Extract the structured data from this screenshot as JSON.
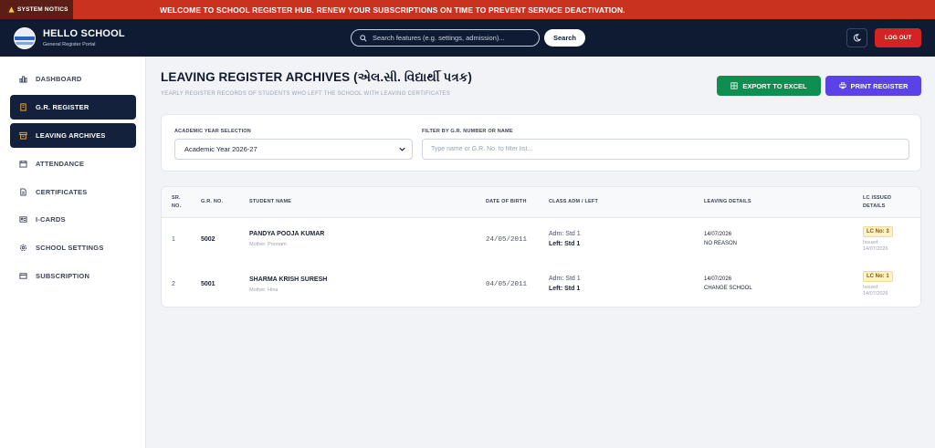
{
  "notice": {
    "tag": "SYSTEM NOTICS",
    "message": "WELCOME TO SCHOOL REGISTER HUB. RENEW YOUR SUBSCRIPTIONS ON TIME TO PREVENT SERVICE DEACTIVATION."
  },
  "header": {
    "title": "HELLO SCHOOL",
    "subtitle": "General Register Portal",
    "search_placeholder": "Search features (e.g. settings, admission)...",
    "search_button": "Search",
    "logout": "LOG OUT",
    "icons": {
      "theme": "moon-icon",
      "search": "search-icon"
    }
  },
  "sidebar": {
    "items": [
      {
        "label": "DASHBOARD",
        "icon": "bar-chart-icon",
        "active": false
      },
      {
        "label": "G.R. REGISTER",
        "icon": "building-icon",
        "active": true
      },
      {
        "label": "LEAVING ARCHIVES",
        "icon": "archive-icon",
        "active": true
      },
      {
        "label": "ATTENDANCE",
        "icon": "calendar-icon",
        "active": false
      },
      {
        "label": "CERTIFICATES",
        "icon": "document-icon",
        "active": false
      },
      {
        "label": "I-CARDS",
        "icon": "id-card-icon",
        "active": false
      },
      {
        "label": "SCHOOL SETTINGS",
        "icon": "gear-icon",
        "active": false
      },
      {
        "label": "SUBSCRIPTION",
        "icon": "credit-card-icon",
        "active": false
      }
    ]
  },
  "main": {
    "title": "LEAVING REGISTER ARCHIVES (એલ.સી. વિદ્યાર્થી પત્રક)",
    "subtitle": "YEARLY REGISTER RECORDS OF STUDENTS WHO LEFT THE SCHOOL WITH LEAVING CERTIFICATES",
    "export_button": "EXPORT TO EXCEL",
    "print_button": "PRINT REGISTER"
  },
  "filters": {
    "year_label": "ACADEMIC YEAR SELECTION",
    "year_value": "Academic Year 2026-27",
    "search_label": "FILTER BY G.R. NUMBER OR NAME",
    "search_placeholder": "Type name or G.R. No. to filter list..."
  },
  "table": {
    "headers": {
      "sr_1": "SR.",
      "sr_2": "NO.",
      "gr": "G.R. NO.",
      "name": "STUDENT NAME",
      "dob": "DATE OF BIRTH",
      "class": "CLASS ADM / LEFT",
      "leaving": "LEAVING DETAILS",
      "lc_1": "LC ISSUED",
      "lc_2": "DETAILS"
    },
    "rows": [
      {
        "sr": "1",
        "gr": "5002",
        "name": "PANDYA POOJA KUMAR",
        "mother": "Mother: Poonam",
        "dob": "24/05/2011",
        "adm": "Adm: Std 1",
        "left": "Left: Std 1",
        "leaving_date": "14/07/2026",
        "reason": "NO REASON",
        "lc_no": "LC No: 3",
        "issued_label": "Issued:",
        "issued_date": "14/07/2026"
      },
      {
        "sr": "2",
        "gr": "5001",
        "name": "SHARMA KRISH SURESH",
        "mother": "Mother: Hina",
        "dob": "04/05/2011",
        "adm": "Adm: Std 1",
        "left": "Left: Std 1",
        "leaving_date": "14/07/2026",
        "reason": "CHANGE SCHOOL",
        "lc_no": "LC No: 1",
        "issued_label": "Issued:",
        "issued_date": "14/07/2026"
      }
    ]
  },
  "colors": {
    "header_bg": "#0f1b33",
    "notice_bg": "#c8321e",
    "export_green": "#0f8f4f",
    "print_purple": "#5a43e6",
    "logout_red": "#d32323",
    "active_nav": "#13213d"
  }
}
